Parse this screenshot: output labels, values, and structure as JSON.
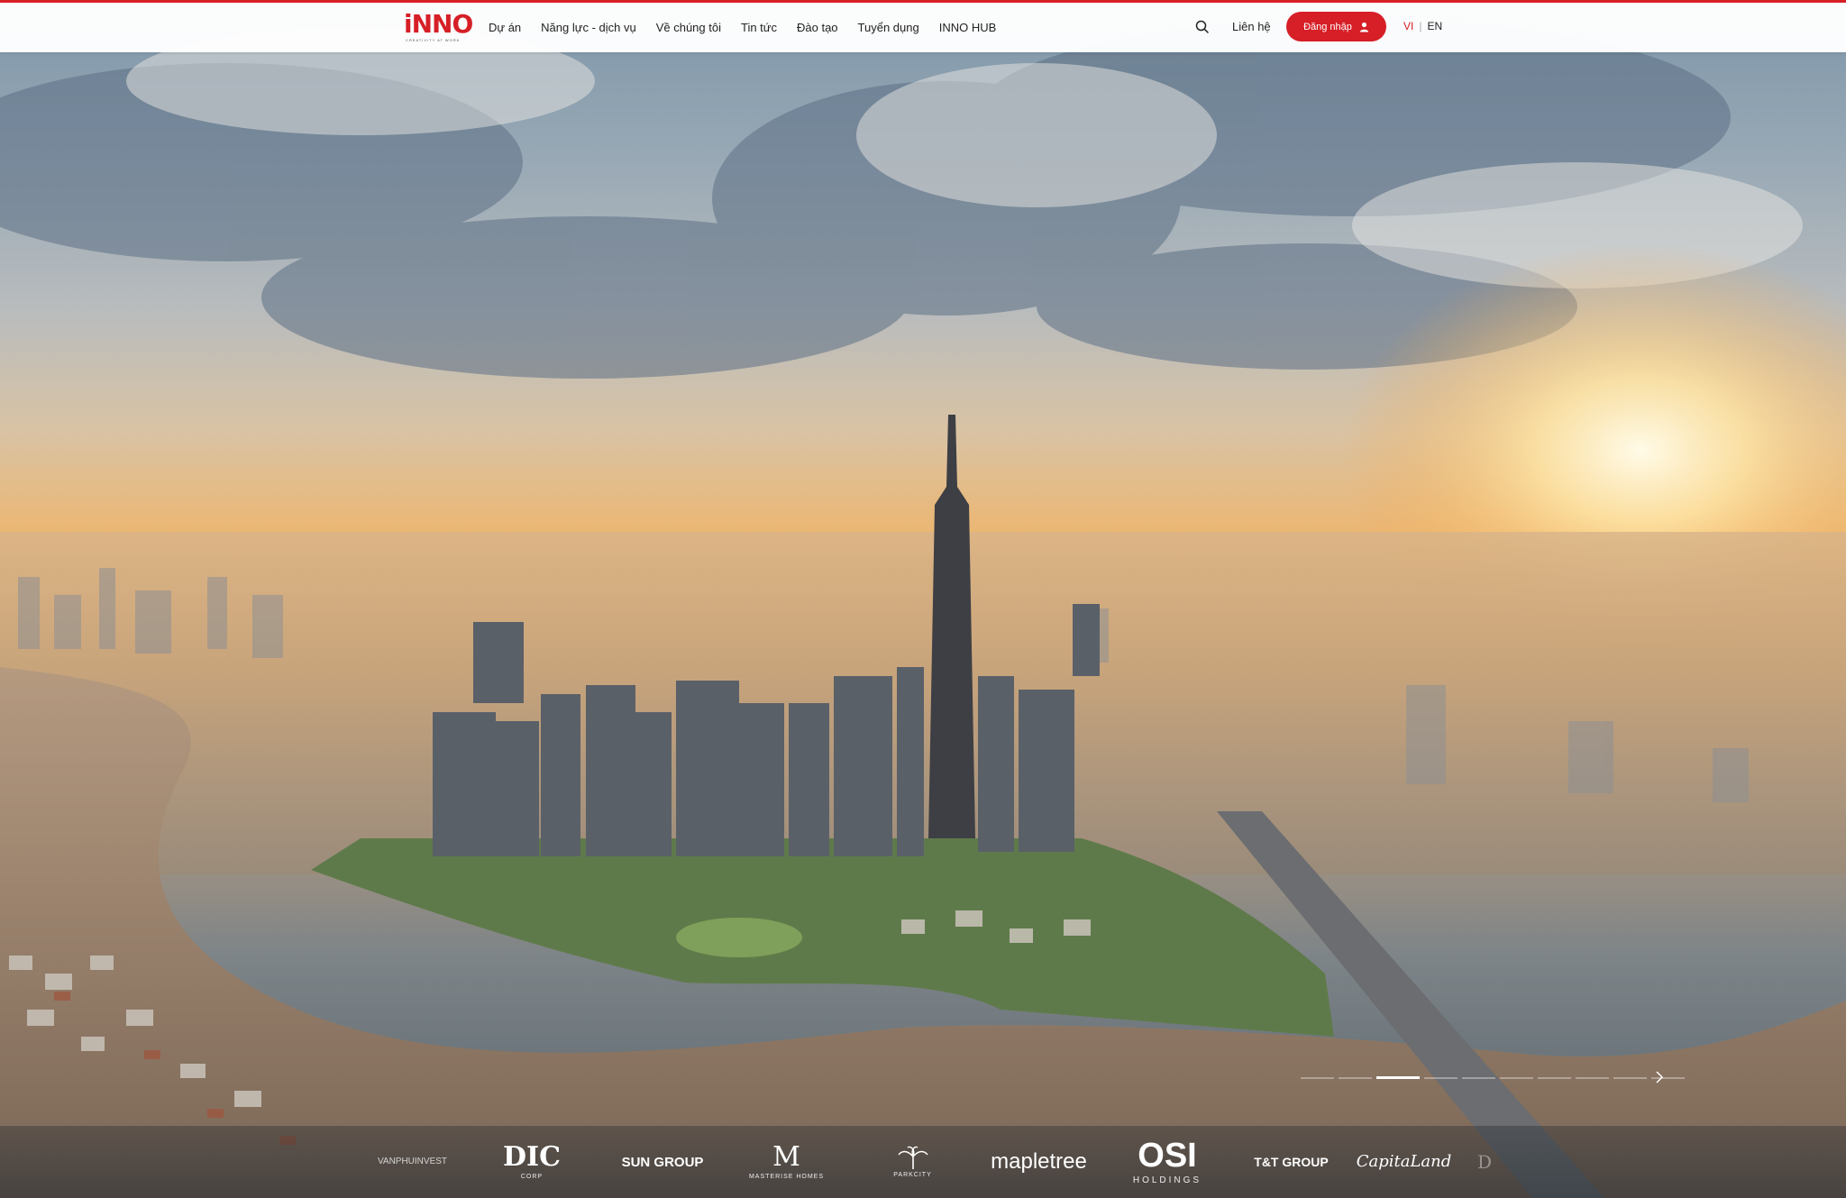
{
  "colors": {
    "brand": "#d61f26",
    "header_bg": "#ffffff",
    "text": "#222222"
  },
  "header": {
    "logo_text": "iNNO",
    "logo_tagline": "CREATIVITY AT WORK",
    "nav": [
      "Dự án",
      "Năng lực - dịch vụ",
      "Về chúng tôi",
      "Tin tức",
      "Đào tạo",
      "Tuyển dụng",
      "INNO HUB"
    ],
    "search_icon": "search-icon",
    "contact": "Liên hệ",
    "login_label": "Đăng nhập",
    "login_icon": "user-icon",
    "lang_vi": "VI",
    "lang_sep": "|",
    "lang_en": "EN"
  },
  "slider": {
    "total": 10,
    "active": 2,
    "next_icon": "chevron-right-icon"
  },
  "partners": [
    {
      "name": "VANPHUINVEST",
      "sub": ""
    },
    {
      "name": "DIC",
      "sub": "CORP"
    },
    {
      "name": "SUN GROUP",
      "sub": ""
    },
    {
      "name": "M",
      "sub": "MASTERISE HOMES"
    },
    {
      "name": "",
      "sub": "PARKCITY"
    },
    {
      "name": "mapletree",
      "sub": ""
    },
    {
      "name": "OSI",
      "sub": "HOLDINGS"
    },
    {
      "name": "T&T GROUP",
      "sub": ""
    },
    {
      "name": "CapitaLand",
      "sub": ""
    },
    {
      "name": "D",
      "sub": ""
    }
  ]
}
